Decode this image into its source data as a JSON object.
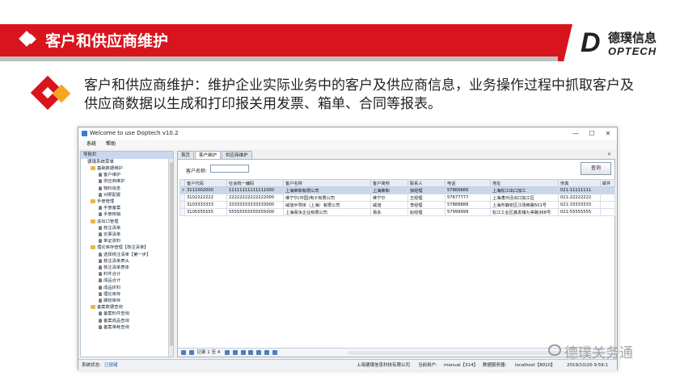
{
  "header": {
    "title": "客户和供应商维护",
    "logo_cn": "德璞信息",
    "logo_en": "OPTECH",
    "logo_d": "D"
  },
  "description": "客户和供应商维护：维护企业实际业务中的客户及供应商信息，业务操作过程中抓取客户及供应商数据以生成和打印报关用发票、箱单、合同等报表。",
  "window": {
    "title": "Welcome to use Doptech v10.2",
    "menu": [
      "系统",
      "帮助"
    ],
    "minimize": "—",
    "maximize": "☐",
    "close": "✕"
  },
  "nav": {
    "header": "导航栏",
    "root": "德璞系统菜单",
    "items": [
      {
        "label": "基础数据维护",
        "level": 1,
        "icon": "folder-icon"
      },
      {
        "label": "客户维护",
        "level": 2,
        "icon": "user-icon"
      },
      {
        "label": "供应商维护",
        "level": 2,
        "icon": "user-icon"
      },
      {
        "label": "物料信息",
        "level": 2,
        "icon": "user-icon"
      },
      {
        "label": "对照配置",
        "level": 2,
        "icon": "user-icon"
      },
      {
        "label": "手册管理",
        "level": 1,
        "icon": "folder-icon"
      },
      {
        "label": "手册备案",
        "level": 2,
        "icon": "user-icon"
      },
      {
        "label": "手册核销",
        "level": 2,
        "icon": "user-icon"
      },
      {
        "label": "进出口管理",
        "level": 1,
        "icon": "folder-icon"
      },
      {
        "label": "核注清单",
        "level": 2,
        "icon": "user-icon"
      },
      {
        "label": "定票清单",
        "level": 2,
        "icon": "user-icon"
      },
      {
        "label": "单证资料",
        "level": 2,
        "icon": "user-icon"
      },
      {
        "label": "理论库存管理【核注清单】",
        "level": 1,
        "icon": "folder-icon"
      },
      {
        "label": "选择核注清单【第一步】",
        "level": 2,
        "icon": "user-icon"
      },
      {
        "label": "核注清单表头",
        "level": 2,
        "icon": "user-icon"
      },
      {
        "label": "核注清单表体",
        "level": 2,
        "icon": "user-icon"
      },
      {
        "label": "料件合计",
        "level": 2,
        "icon": "user-icon"
      },
      {
        "label": "成品合计",
        "level": 2,
        "icon": "user-icon"
      },
      {
        "label": "成品折料",
        "level": 2,
        "icon": "user-icon"
      },
      {
        "label": "理论库存",
        "level": 2,
        "icon": "user-icon"
      },
      {
        "label": "期初库存",
        "level": 2,
        "icon": "user-icon"
      },
      {
        "label": "备案数据查询",
        "level": 1,
        "icon": "folder-icon"
      },
      {
        "label": "备案料件查询",
        "level": 2,
        "icon": "user-icon"
      },
      {
        "label": "备案成品查询",
        "level": 2,
        "icon": "user-icon"
      },
      {
        "label": "备案单耗查询",
        "level": 2,
        "icon": "user-icon"
      }
    ]
  },
  "tabs": [
    {
      "label": "首页",
      "active": false
    },
    {
      "label": "客户维护",
      "active": true
    },
    {
      "label": "供应商维护",
      "active": false
    }
  ],
  "tab_close": "✕",
  "search": {
    "label": "客户名称:",
    "value": "",
    "button": "查询"
  },
  "table": {
    "columns": [
      "客户代码",
      "社会统一编码",
      "客户名称",
      "客户简称",
      "联系人",
      "电话",
      "地址",
      "传真",
      "邮件"
    ],
    "rows": [
      [
        "3111002000",
        "11111111111111000",
        "上海荣和有限公司",
        "上海荣和",
        "徐经理",
        "57866666",
        "上海松江出口加工",
        "021-11111111",
        ""
      ],
      [
        "3102222222",
        "22222222222222000",
        "维宁尔(中国)电子有限公司",
        "维宁尔",
        "王经理",
        "57677777",
        "上海漕河泾出口加工区",
        "021-22222222",
        ""
      ],
      [
        "3103333333",
        "33333333333333000",
        "威旭半导体（上海）有限公司",
        "威旭",
        "李经理",
        "57888888",
        "上海市静安区江场西路501号",
        "021-33333333",
        ""
      ],
      [
        "3105555555",
        "55555555555555000",
        "上海易永企业有限公司",
        "易永",
        "赵经理",
        "57999999",
        "松江工业区鑫发镇九亭路368号",
        "021-55555555",
        ""
      ]
    ],
    "row_indicator": ">"
  },
  "pager": {
    "text": "记录 1 至 4"
  },
  "status": {
    "label": "系统状态:",
    "state": "已就绪",
    "company": "上海德璞信息科技有限公司",
    "user_label": "当前用户:",
    "user": "manual【314】",
    "server_label": "数据服务器:",
    "server": "localhost【8010】",
    "time": "2019/10/20 9:59:1"
  },
  "watermark": "德璞关务通",
  "colors": {
    "brand_red": "#d8141c",
    "accent_orange": "#f5a623",
    "selected_row": "#c8d6ea"
  }
}
